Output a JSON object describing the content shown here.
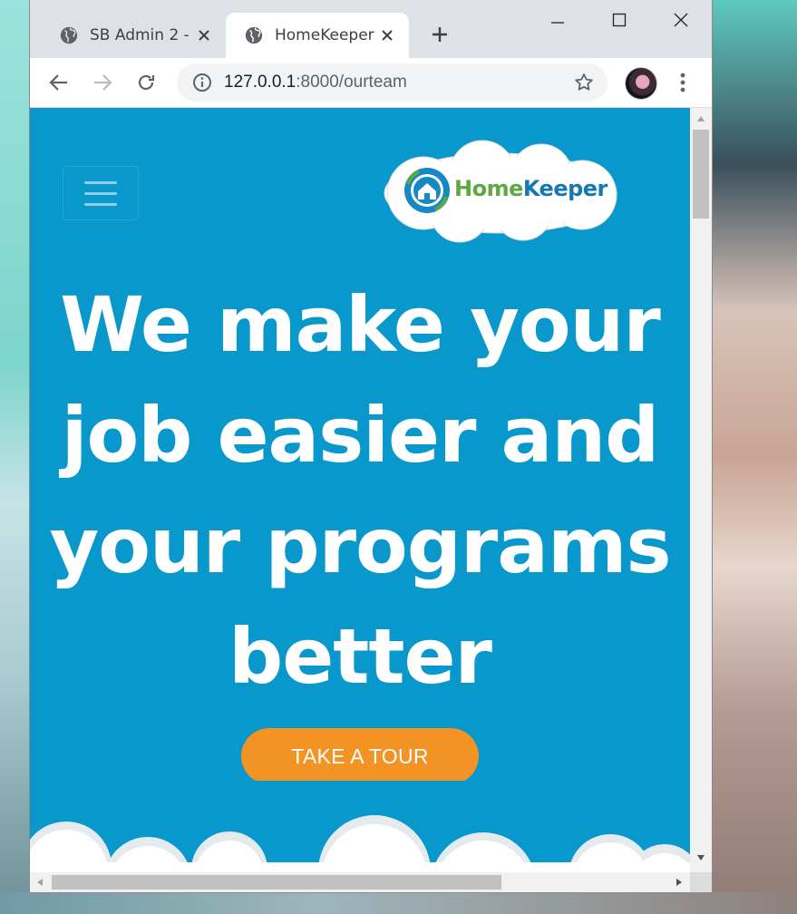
{
  "browser": {
    "tabs": [
      {
        "title": "SB Admin 2 -",
        "active": false
      },
      {
        "title": "HomeKeeper",
        "active": true
      }
    ],
    "url_host": "127.0.0.1",
    "url_rest": ":8000/ourteam"
  },
  "page": {
    "logo_part1": "Home",
    "logo_part2": "Keeper",
    "hero_lines": [
      "We make your",
      "job easier and",
      "your programs",
      "better"
    ],
    "cta_label": "TAKE A TOUR"
  },
  "colors": {
    "page_bg": "#0898cc",
    "cta_bg": "#f39324",
    "logo_green": "#5ea842",
    "logo_blue": "#1478b4"
  }
}
